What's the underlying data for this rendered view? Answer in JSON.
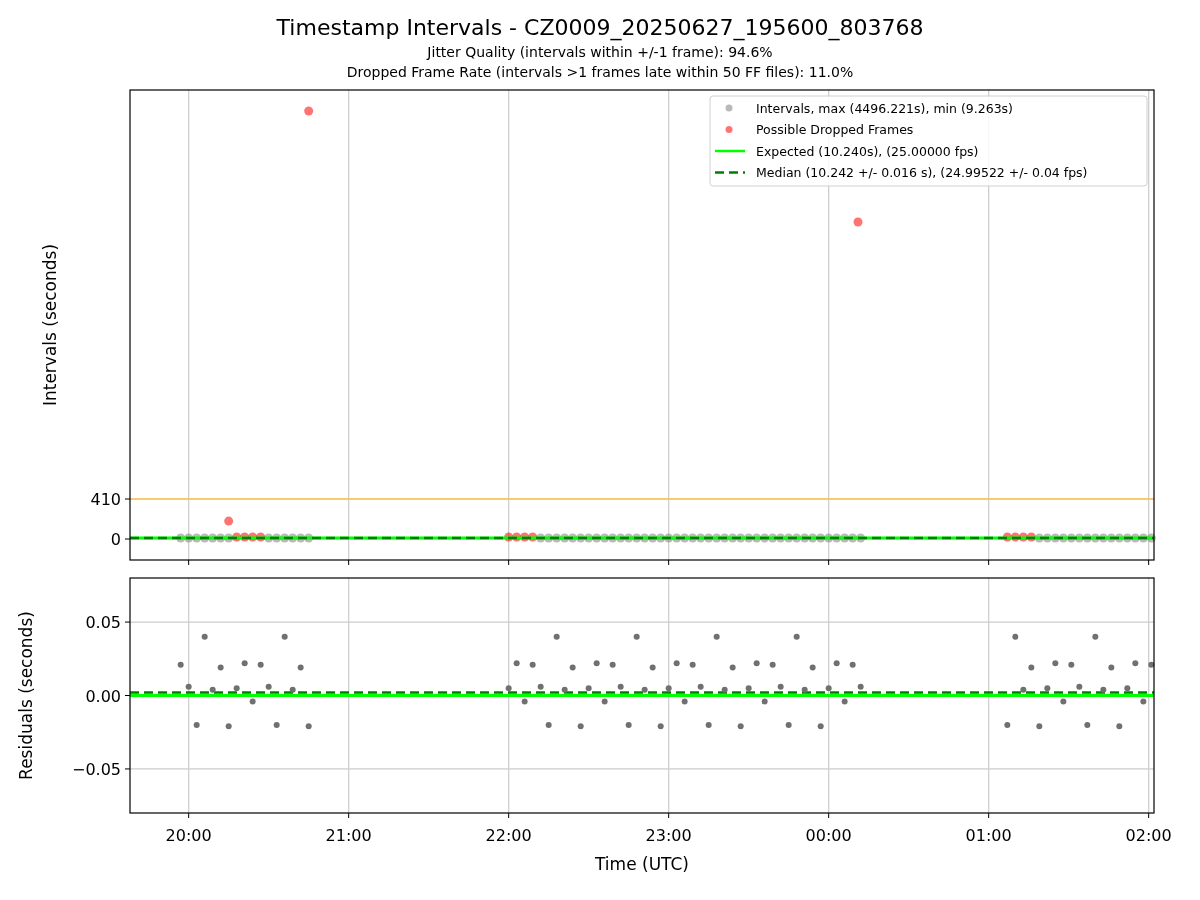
{
  "figure": {
    "title": "Timestamp Intervals - CZ0009_20250627_195600_803768",
    "subtitles": [
      "Jitter Quality (intervals within +/-1 frame): 94.6%",
      "Dropped Frame Rate (intervals >1 frames late within 50 FF files): 11.0%"
    ]
  },
  "intervals_panel": {
    "chart_data": {
      "type": "scatter",
      "ylabel": "Intervals (seconds)",
      "xlim": [
        "2025-06-27T19:38",
        "2025-06-28T02:02"
      ],
      "ylim": [
        -215,
        4602
      ],
      "yticks": [
        {
          "value": 0,
          "label": "0"
        },
        {
          "value": 410,
          "label": "410"
        }
      ],
      "grid": true,
      "legend": "upper right",
      "ref_lines": [
        {
          "axis": "y",
          "value": 410,
          "color": "#ffc04d"
        }
      ],
      "series": [
        {
          "name": "Intervals, max (4496.221s), min (9.263s)",
          "type": "scatter",
          "color": "#808080",
          "x": [
            "2025-06-27T19:57",
            "2025-06-27T20:00",
            "2025-06-27T20:03",
            "2025-06-27T20:06",
            "2025-06-27T20:09",
            "2025-06-27T20:12",
            "2025-06-27T20:15",
            "2025-06-27T20:30",
            "2025-06-27T20:33",
            "2025-06-27T20:36",
            "2025-06-27T20:39",
            "2025-06-27T20:42",
            "2025-06-27T20:45",
            "2025-06-27T22:12",
            "2025-06-27T22:15",
            "2025-06-27T22:18",
            "2025-06-27T22:21",
            "2025-06-27T22:24",
            "2025-06-27T22:27",
            "2025-06-27T22:30",
            "2025-06-27T22:33",
            "2025-06-27T22:36",
            "2025-06-27T22:39",
            "2025-06-27T22:42",
            "2025-06-27T22:45",
            "2025-06-27T22:48",
            "2025-06-27T22:51",
            "2025-06-27T22:54",
            "2025-06-27T22:57",
            "2025-06-27T23:00",
            "2025-06-27T23:03",
            "2025-06-27T23:06",
            "2025-06-27T23:09",
            "2025-06-27T23:12",
            "2025-06-27T23:15",
            "2025-06-27T23:18",
            "2025-06-27T23:21",
            "2025-06-27T23:24",
            "2025-06-27T23:27",
            "2025-06-27T23:30",
            "2025-06-27T23:33",
            "2025-06-27T23:36",
            "2025-06-27T23:39",
            "2025-06-27T23:42",
            "2025-06-27T23:45",
            "2025-06-27T23:48",
            "2025-06-27T23:51",
            "2025-06-27T23:54",
            "2025-06-27T23:57",
            "2025-06-28T00:00",
            "2025-06-28T00:03",
            "2025-06-28T00:06",
            "2025-06-28T00:09",
            "2025-06-28T00:12",
            "2025-06-28T01:19",
            "2025-06-28T01:22",
            "2025-06-28T01:25",
            "2025-06-28T01:28",
            "2025-06-28T01:31",
            "2025-06-28T01:34",
            "2025-06-28T01:37",
            "2025-06-28T01:40",
            "2025-06-28T01:43",
            "2025-06-28T01:46",
            "2025-06-28T01:49",
            "2025-06-28T01:52",
            "2025-06-28T01:55",
            "2025-06-28T01:58",
            "2025-06-28T02:01"
          ],
          "values": [
            10.24,
            10.24,
            10.24,
            10.24,
            10.24,
            10.24,
            10.24,
            10.24,
            10.24,
            10.24,
            10.24,
            10.24,
            10.24,
            10.24,
            10.24,
            10.24,
            10.24,
            10.24,
            10.24,
            10.24,
            10.24,
            10.24,
            10.24,
            10.24,
            10.24,
            10.24,
            10.24,
            10.24,
            10.24,
            10.24,
            10.24,
            10.24,
            10.24,
            10.24,
            10.24,
            10.24,
            10.24,
            10.24,
            10.24,
            10.24,
            10.24,
            10.24,
            10.24,
            10.24,
            10.24,
            10.24,
            10.24,
            10.24,
            10.24,
            10.24,
            10.24,
            10.24,
            10.24,
            10.24,
            10.24,
            10.24,
            10.24,
            10.24,
            10.24,
            10.24,
            10.24,
            10.24,
            10.24,
            10.24,
            10.24,
            10.24,
            10.24,
            10.24,
            10.24
          ]
        },
        {
          "name": "Possible Dropped Frames",
          "type": "scatter",
          "color": "#ff0000",
          "x": [
            "2025-06-27T20:15",
            "2025-06-27T20:18",
            "2025-06-27T20:21",
            "2025-06-27T20:24",
            "2025-06-27T20:27",
            "2025-06-27T20:45",
            "2025-06-27T22:00",
            "2025-06-27T22:03",
            "2025-06-27T22:06",
            "2025-06-27T22:09",
            "2025-06-28T00:11",
            "2025-06-28T01:07",
            "2025-06-28T01:10",
            "2025-06-28T01:13",
            "2025-06-28T01:16"
          ],
          "values": [
            184,
            20.5,
            20.5,
            20.5,
            20.5,
            4387,
            20.5,
            20.5,
            20.5,
            20.5,
            3249,
            20.5,
            20.5,
            20.5,
            20.5
          ]
        },
        {
          "name": "Expected (10.240s), (25.00000 fps)",
          "type": "line",
          "line_style": "solid",
          "color": "#00ff00",
          "x": [
            "2025-06-27T19:38",
            "2025-06-28T02:02"
          ],
          "values": [
            10.24,
            10.24
          ]
        },
        {
          "name": "Median (10.242 +/- 0.016 s), (24.99522 +/- 0.04 fps)",
          "type": "line",
          "line_style": "dashed",
          "color": "#008000",
          "x": [
            "2025-06-27T19:38",
            "2025-06-28T02:02"
          ],
          "values": [
            10.242,
            10.242
          ]
        }
      ]
    }
  },
  "residuals_panel": {
    "chart_data": {
      "type": "scatter",
      "xlabel": "Time (UTC)",
      "ylabel": "Residuals (seconds)",
      "xlim": [
        "2025-06-27T19:38",
        "2025-06-28T02:02"
      ],
      "ylim": [
        -0.08,
        0.08
      ],
      "grid": true,
      "xticks": [
        {
          "value": "2025-06-27T20:00",
          "label": "20:00"
        },
        {
          "value": "2025-06-27T21:00",
          "label": "21:00"
        },
        {
          "value": "2025-06-27T22:00",
          "label": "22:00"
        },
        {
          "value": "2025-06-27T23:00",
          "label": "23:00"
        },
        {
          "value": "2025-06-28T00:00",
          "label": "00:00"
        },
        {
          "value": "2025-06-28T01:00",
          "label": "01:00"
        },
        {
          "value": "2025-06-28T02:00",
          "label": "02:00"
        }
      ],
      "yticks": [
        {
          "value": -0.05,
          "label": "−0.05"
        },
        {
          "value": 0,
          "label": "0.00"
        },
        {
          "value": 0.05,
          "label": "0.05"
        }
      ],
      "series": [
        {
          "type": "scatter",
          "color": "#707070",
          "x": [
            "2025-06-27T19:57",
            "2025-06-27T20:00",
            "2025-06-27T20:03",
            "2025-06-27T20:06",
            "2025-06-27T20:09",
            "2025-06-27T20:12",
            "2025-06-27T20:15",
            "2025-06-27T20:18",
            "2025-06-27T20:21",
            "2025-06-27T20:24",
            "2025-06-27T20:27",
            "2025-06-27T20:30",
            "2025-06-27T20:33",
            "2025-06-27T20:36",
            "2025-06-27T20:39",
            "2025-06-27T20:42",
            "2025-06-27T20:45",
            "2025-06-27T22:00",
            "2025-06-27T22:03",
            "2025-06-27T22:06",
            "2025-06-27T22:09",
            "2025-06-27T22:12",
            "2025-06-27T22:15",
            "2025-06-27T22:18",
            "2025-06-27T22:21",
            "2025-06-27T22:24",
            "2025-06-27T22:27",
            "2025-06-27T22:30",
            "2025-06-27T22:33",
            "2025-06-27T22:36",
            "2025-06-27T22:39",
            "2025-06-27T22:42",
            "2025-06-27T22:45",
            "2025-06-27T22:48",
            "2025-06-27T22:51",
            "2025-06-27T22:54",
            "2025-06-27T22:57",
            "2025-06-27T23:00",
            "2025-06-27T23:03",
            "2025-06-27T23:06",
            "2025-06-27T23:09",
            "2025-06-27T23:12",
            "2025-06-27T23:15",
            "2025-06-27T23:18",
            "2025-06-27T23:21",
            "2025-06-27T23:24",
            "2025-06-27T23:27",
            "2025-06-27T23:30",
            "2025-06-27T23:33",
            "2025-06-27T23:36",
            "2025-06-27T23:39",
            "2025-06-27T23:42",
            "2025-06-27T23:45",
            "2025-06-27T23:48",
            "2025-06-27T23:51",
            "2025-06-27T23:54",
            "2025-06-27T23:57",
            "2025-06-28T00:00",
            "2025-06-28T00:03",
            "2025-06-28T00:06",
            "2025-06-28T00:09",
            "2025-06-28T00:12",
            "2025-06-28T01:07",
            "2025-06-28T01:10",
            "2025-06-28T01:13",
            "2025-06-28T01:16",
            "2025-06-28T01:19",
            "2025-06-28T01:22",
            "2025-06-28T01:25",
            "2025-06-28T01:28",
            "2025-06-28T01:31",
            "2025-06-28T01:34",
            "2025-06-28T01:37",
            "2025-06-28T01:40",
            "2025-06-28T01:43",
            "2025-06-28T01:46",
            "2025-06-28T01:49",
            "2025-06-28T01:52",
            "2025-06-28T01:55",
            "2025-06-28T01:58",
            "2025-06-28T02:01"
          ],
          "values": [
            0.021,
            0.006,
            -0.02,
            0.04,
            0.004,
            0.019,
            -0.021,
            0.005,
            0.022,
            -0.004,
            0.021,
            0.006,
            -0.02,
            0.04,
            0.004,
            0.019,
            -0.021,
            0.005,
            0.022,
            -0.004,
            0.021,
            0.006,
            -0.02,
            0.04,
            0.004,
            0.019,
            -0.021,
            0.005,
            0.022,
            -0.004,
            0.021,
            0.006,
            -0.02,
            0.04,
            0.004,
            0.019,
            -0.021,
            0.005,
            0.022,
            -0.004,
            0.021,
            0.006,
            -0.02,
            0.04,
            0.004,
            0.019,
            -0.021,
            0.005,
            0.022,
            -0.004,
            0.021,
            0.006,
            -0.02,
            0.04,
            0.004,
            0.019,
            -0.021,
            0.005,
            0.022,
            -0.004,
            0.021,
            0.006,
            -0.02,
            0.04,
            0.004,
            0.019,
            -0.021,
            0.005,
            0.022,
            -0.004,
            0.021,
            0.006,
            -0.02,
            0.04,
            0.004,
            0.019,
            -0.021,
            0.005,
            0.022,
            -0.004,
            0.021
          ]
        },
        {
          "type": "line",
          "line_style": "solid",
          "color": "#00ff00",
          "x": [
            "2025-06-27T19:38",
            "2025-06-28T02:02"
          ],
          "values": [
            0,
            0
          ]
        },
        {
          "type": "line",
          "line_style": "dashed",
          "color": "#008000",
          "x": [
            "2025-06-27T19:38",
            "2025-06-28T02:02"
          ],
          "values": [
            0.002,
            0.002
          ]
        }
      ]
    }
  }
}
